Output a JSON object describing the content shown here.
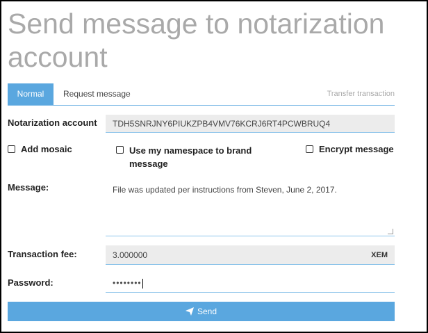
{
  "page": {
    "title": "Send message to notarization account"
  },
  "tabs": {
    "normal": "Normal",
    "request": "Request message",
    "transfer": "Transfer transaction"
  },
  "form": {
    "account_label": "Notarization account",
    "account_value": "TDH5SNRJNY6PIUKZPB4VMV76KCRJ6RT4PCWBRUQ4",
    "add_mosaic": "Add mosaic",
    "namespace_brand": "Use my namespace to brand message",
    "encrypt": "Encrypt message",
    "message_label": "Message:",
    "message_value": "File was updated per instructions from Steven, June 2, 2017.",
    "fee_label": "Transaction fee:",
    "fee_value": "3.000000",
    "fee_unit": "XEM",
    "password_label": "Password:",
    "password_value": "••••••••",
    "send_label": "Send"
  },
  "icons": {
    "send": "paper-plane-icon",
    "checkbox": "checkbox-icon"
  },
  "colors": {
    "accent": "#5aa7df",
    "title": "#a9a9a9",
    "field_bg": "#ececec"
  }
}
